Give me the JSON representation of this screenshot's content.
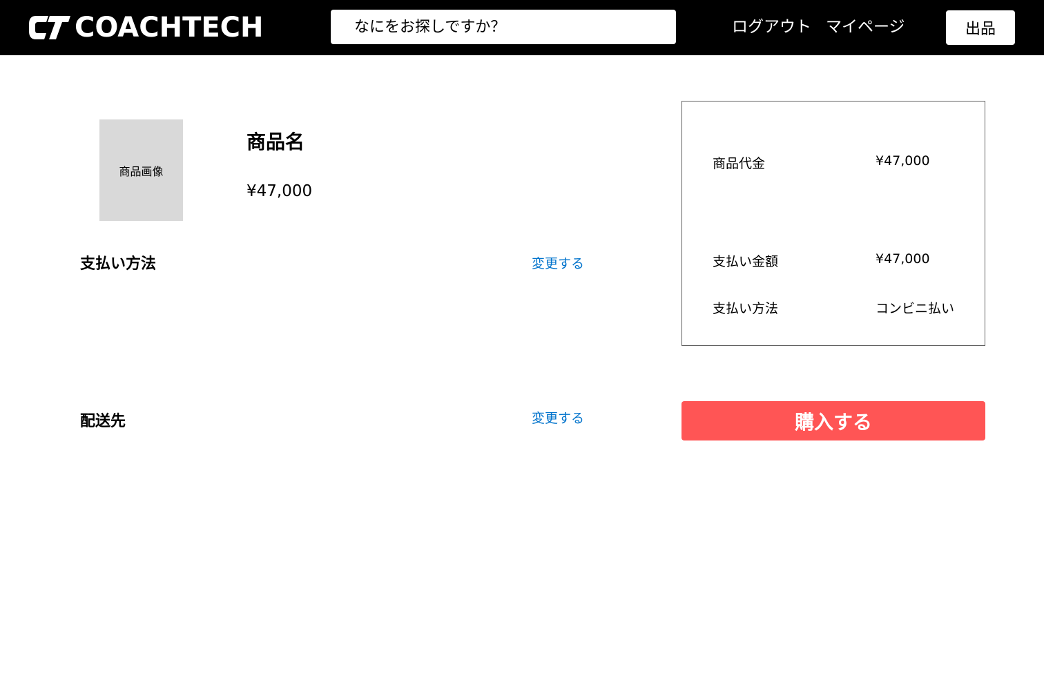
{
  "header": {
    "logo_text": "COACHTECH",
    "search_placeholder": "なにをお探しですか？",
    "logout_label": "ログアウト",
    "mypage_label": "マイページ",
    "sell_label": "出品"
  },
  "product": {
    "image_placeholder": "商品画像",
    "name": "商品名",
    "price": "¥47,000"
  },
  "payment_section": {
    "title": "支払い方法",
    "change_label": "変更する"
  },
  "shipping_section": {
    "title": "配送先",
    "change_label": "変更する"
  },
  "summary": {
    "item_price_label": "商品代金",
    "item_price_value": "¥47,000",
    "total_label": "支払い金額",
    "total_value": "¥47,000",
    "method_label": "支払い方法",
    "method_value": "コンビニ払い"
  },
  "buy_button_label": "購入する",
  "colors": {
    "header_bg": "#000000",
    "buy_button": "#ff5555",
    "link": "#0073cc",
    "image_placeholder_bg": "#d9d9d9"
  }
}
